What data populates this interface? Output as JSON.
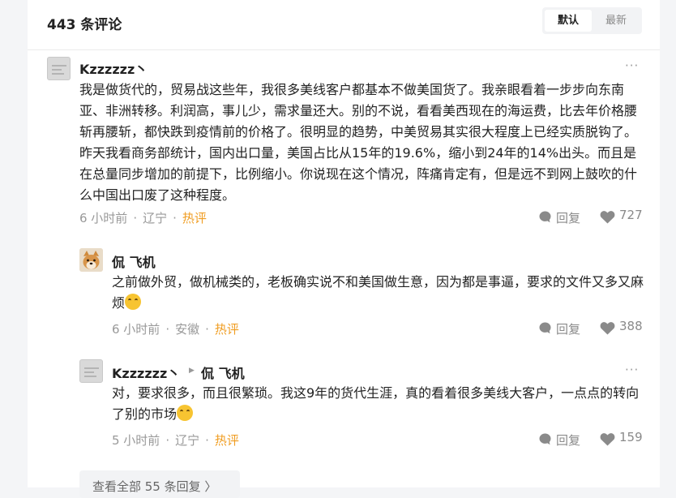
{
  "header": {
    "count_label": "443 条评论",
    "sort_default": "默认",
    "sort_latest": "最新"
  },
  "comments": [
    {
      "author": "Kzzzzzz丶",
      "text": "我是做货代的，贸易战这些年，我很多美线客户都基本不做美国货了。我亲眼看着一步步向东南亚、非洲转移。利润高，事儿少，需求量还大。别的不说，看看美西现在的海运费，比去年价格腰斩再腰斩，都快跌到疫情前的价格了。很明显的趋势，中美贸易其实很大程度上已经实质脱钩了。昨天我看商务部统计，国内出口量，美国占比从15年的19.6%，缩小到24年的14%出头。而且是在总量同步增加的前提下，比例缩小。你说现在这个情况，阵痛肯定有，但是远不到网上鼓吹的什么中国出口废了这种程度。",
      "time": "6 小时前",
      "location": "辽宁",
      "tag": "热评",
      "reply_label": "回复",
      "likes": "727"
    },
    {
      "author": "侃 飞机",
      "text": "之前做外贸，做机械类的，老板确实说不和美国做生意，因为都是事逼，要求的文件又多又麻烦",
      "emoji": "rolling-laughing-emoji",
      "time": "6 小时前",
      "location": "安徽",
      "tag": "热评",
      "reply_label": "回复",
      "likes": "388"
    },
    {
      "author": "Kzzzzzz丶",
      "reply_to": "侃 飞机",
      "text": "对，要求很多，而且很繁琐。我这9年的货代生涯，真的看着很多美线大客户，一点点的转向了别的市场",
      "emoji": "hand-over-mouth-emoji",
      "time": "5 小时前",
      "location": "辽宁",
      "tag": "热评",
      "reply_label": "回复",
      "likes": "159"
    }
  ],
  "view_all_replies": "查看全部 55 条回复 〉",
  "more_glyph": "···",
  "colors": {
    "hot": "#f09d22",
    "muted": "#999999",
    "text": "#222222"
  }
}
